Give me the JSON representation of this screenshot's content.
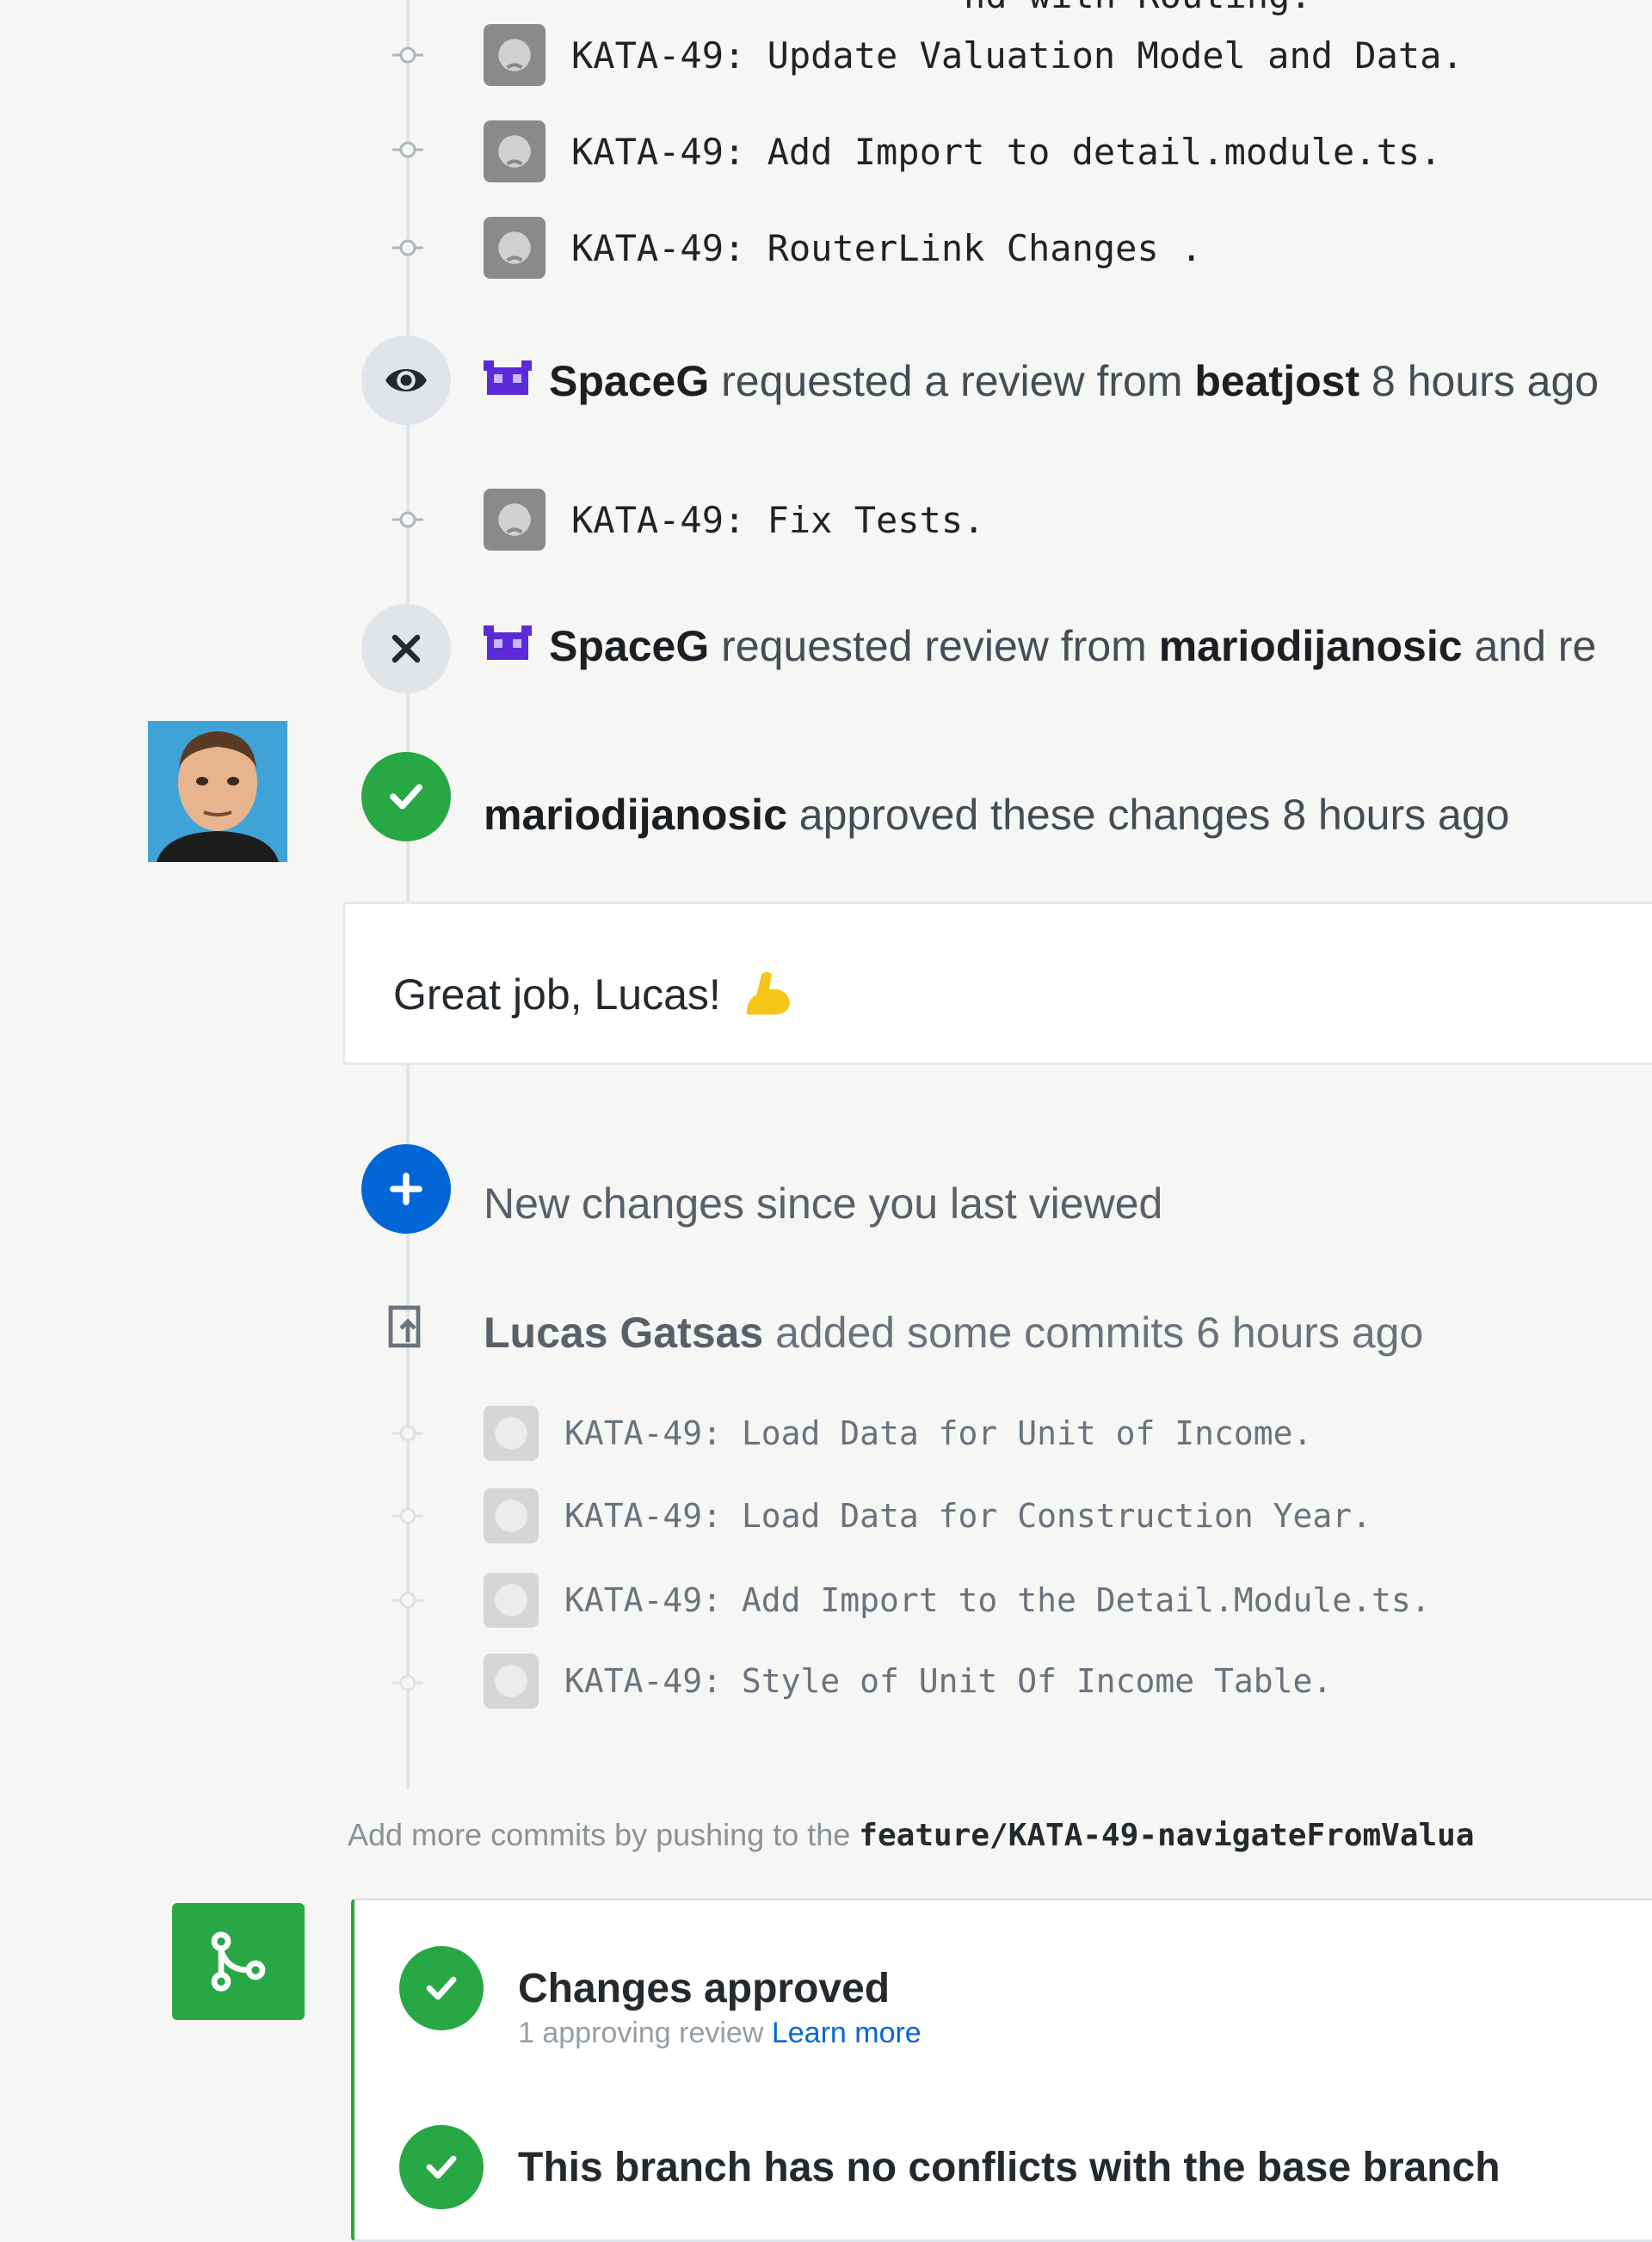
{
  "timeline": {
    "top_partial_text": "nd with Routing.",
    "commits_a": [
      {
        "message": "KATA-49: Update Valuation Model and Data."
      },
      {
        "message": "KATA-49: Add Import to detail.module.ts."
      },
      {
        "message": "KATA-49: RouterLink Changes ."
      }
    ],
    "review_request_1": {
      "actor": "SpaceG",
      "action": "requested a review from",
      "target": "beatjost",
      "time": "8 hours ago"
    },
    "commits_b": [
      {
        "message": "KATA-49: Fix Tests."
      }
    ],
    "review_request_2": {
      "actor": "SpaceG",
      "action": "requested review from",
      "target": "mariodijanosic",
      "tail": "and re"
    },
    "approval": {
      "actor": "mariodijanosic",
      "action": "approved these changes",
      "time": "8 hours ago",
      "comment": "Great job, Lucas!"
    },
    "new_changes_label": "New changes since you last viewed",
    "push_event": {
      "actor": "Lucas Gatsas",
      "action": "added some commits",
      "time": "6 hours ago"
    },
    "commits_c": [
      {
        "message": "KATA-49: Load Data for Unit of Income."
      },
      {
        "message": "KATA-49: Load Data for Construction Year."
      },
      {
        "message": "KATA-49: Add Import to the Detail.Module.ts."
      },
      {
        "message": "KATA-49: Style of Unit Of Income Table."
      }
    ]
  },
  "push_hint": {
    "text": "Add more commits by pushing to the",
    "branch": "feature/KATA-49-navigateFromValua"
  },
  "merge_box": {
    "approved_title": "Changes approved",
    "approved_sub": "1 approving review",
    "learn_more": "Learn more",
    "conflicts_title": "This branch has no conflicts with the base branch"
  },
  "icons": {
    "commit": "git-commit-icon",
    "eye": "eye-icon",
    "close": "x-icon",
    "check": "check-icon",
    "plus": "plus-icon",
    "push": "repo-push-icon",
    "merge": "git-merge-icon"
  },
  "colors": {
    "green": "#28a745",
    "blue": "#0366d6",
    "spaceg_purple": "#5b2bd9"
  }
}
